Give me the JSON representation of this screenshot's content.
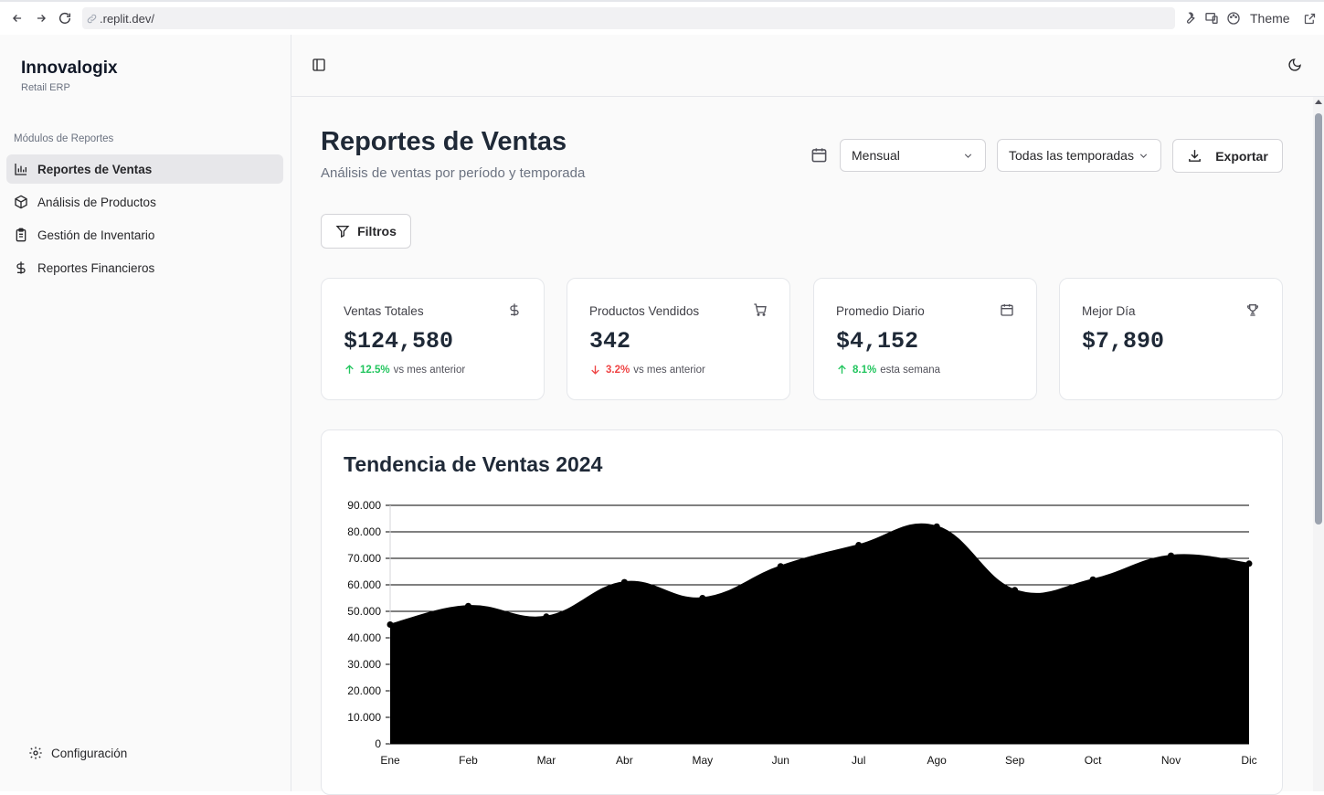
{
  "browser": {
    "url": ".replit.dev/",
    "theme_label": "Theme"
  },
  "sidebar": {
    "brand": "Innovalogix",
    "brand_sub": "Retail ERP",
    "section_label": "Módulos de Reportes",
    "items": [
      {
        "label": "Reportes de Ventas",
        "icon": "bar-chart-icon",
        "active": true
      },
      {
        "label": "Análisis de Productos",
        "icon": "package-icon"
      },
      {
        "label": "Gestión de Inventario",
        "icon": "clipboard-icon"
      },
      {
        "label": "Reportes Financieros",
        "icon": "dollar-icon"
      }
    ],
    "config_label": "Configuración"
  },
  "header": {
    "title": "Reportes de Ventas",
    "subtitle": "Análisis de ventas por período y temporada",
    "period_select": "Mensual",
    "season_select": "Todas las temporadas",
    "export_label": "Exportar",
    "filters_label": "Filtros"
  },
  "cards": [
    {
      "title": "Ventas Totales",
      "value": "$124,580",
      "change": "12.5%",
      "direction": "up",
      "note": "vs mes anterior",
      "icon": "dollar-icon"
    },
    {
      "title": "Productos Vendidos",
      "value": "342",
      "change": "3.2%",
      "direction": "down",
      "note": "vs mes anterior",
      "icon": "cart-icon"
    },
    {
      "title": "Promedio Diario",
      "value": "$4,152",
      "change": "8.1%",
      "direction": "up",
      "note": "esta semana",
      "icon": "calendar-icon"
    },
    {
      "title": "Mejor Día",
      "value": "$7,890",
      "icon": "trophy-icon"
    }
  ],
  "colors": {
    "up": "#22c55e",
    "down": "#ef4444",
    "area_fill": "#000000"
  },
  "chart_data": {
    "type": "area",
    "title": "Tendencia de Ventas 2024",
    "categories": [
      "Ene",
      "Feb",
      "Mar",
      "Abr",
      "May",
      "Jun",
      "Jul",
      "Ago",
      "Sep",
      "Oct",
      "Nov",
      "Dic"
    ],
    "values": [
      45000,
      52000,
      48000,
      61000,
      55000,
      67000,
      75000,
      82000,
      58000,
      62000,
      71000,
      68000
    ],
    "y_ticks": [
      "0",
      "10.000",
      "20.000",
      "30.000",
      "40.000",
      "50.000",
      "60.000",
      "70.000",
      "80.000",
      "90.000"
    ],
    "ylim": [
      0,
      90000
    ],
    "grid": true
  }
}
